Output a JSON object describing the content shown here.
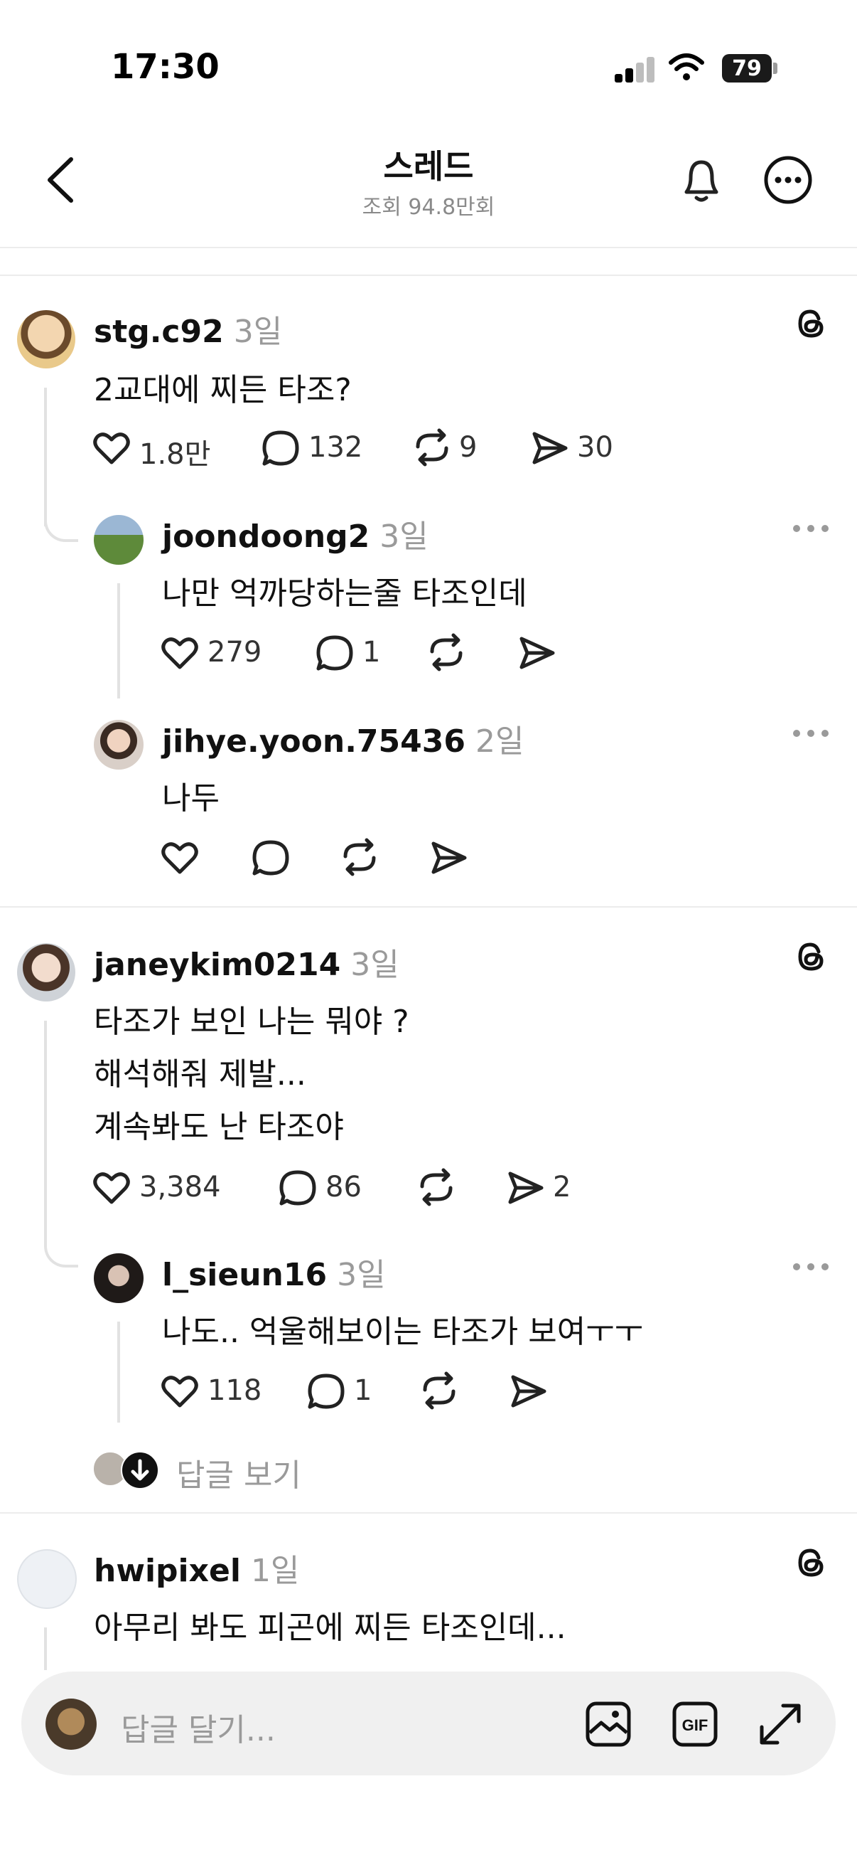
{
  "status": {
    "time": "17:30",
    "battery": "79"
  },
  "header": {
    "title": "스레드",
    "subtitle": "조회 94.8만회"
  },
  "posts": [
    {
      "user": "stg.c92",
      "time": "3일",
      "lines": [
        "2교대에 찌든 타조?"
      ],
      "likes": "1.8만",
      "comments": "132",
      "reposts": "9",
      "shares": "30"
    },
    {
      "user": "joondoong2",
      "time": "3일",
      "lines": [
        "나만 억까당하는줄 타조인데"
      ],
      "likes": "279",
      "comments": "1",
      "reposts": "",
      "shares": ""
    },
    {
      "user": "jihye.yoon.75436",
      "time": "2일",
      "lines": [
        "나두"
      ],
      "likes": "",
      "comments": "",
      "reposts": "",
      "shares": ""
    },
    {
      "user": "janeykim0214",
      "time": "3일",
      "lines": [
        "타조가 보인 나는 뭐야 ?",
        "해석해줘 제발...",
        "계속봐도 난 타조야"
      ],
      "likes": "3,384",
      "comments": "86",
      "reposts": "",
      "shares": "2"
    },
    {
      "user": "l_sieun16",
      "time": "3일",
      "lines": [
        "나도.. 억울해보이는 타조가 보여ㅜㅜ"
      ],
      "likes": "118",
      "comments": "1",
      "reposts": "",
      "shares": ""
    },
    {
      "user": "hwipixel",
      "time": "1일",
      "lines": [
        "아무리 봐도 피곤에 찌든 타조인데..."
      ]
    }
  ],
  "view_replies": "답글 보기",
  "reply_input": {
    "placeholder": "답글 달기..."
  },
  "icons": {
    "back": "chevron-left-icon",
    "bell": "bell-icon",
    "more": "more-circle-icon",
    "threads": "threads-logo-icon",
    "like": "heart-icon",
    "comment": "comment-bubble-icon",
    "repost": "repost-icon",
    "share": "send-icon",
    "image": "image-icon",
    "gif": "gif-icon",
    "expand": "expand-icon"
  }
}
